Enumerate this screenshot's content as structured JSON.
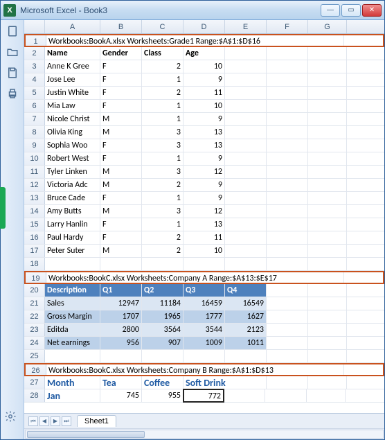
{
  "window": {
    "title": "Microsoft Excel - Book3",
    "min": "—",
    "max": "▭",
    "close": "✕"
  },
  "columns": [
    "A",
    "B",
    "C",
    "D",
    "E",
    "F",
    "G"
  ],
  "info1": "Workbooks:BookA.xlsx   Worksheets:Grade1   Range:$A$1:$D$16",
  "hdr1": {
    "a": "Name",
    "b": "Gender",
    "c": "Class",
    "d": "Age"
  },
  "t1": [
    {
      "n": "3",
      "a": "Anne K Gree",
      "b": "F",
      "c": "2",
      "d": "10"
    },
    {
      "n": "4",
      "a": "Jose Lee",
      "b": "F",
      "c": "1",
      "d": "9"
    },
    {
      "n": "5",
      "a": "Justin White",
      "b": "F",
      "c": "2",
      "d": "11"
    },
    {
      "n": "6",
      "a": "Mia Law",
      "b": "F",
      "c": "1",
      "d": "10"
    },
    {
      "n": "7",
      "a": "Nicole Christ",
      "b": "M",
      "c": "1",
      "d": "9"
    },
    {
      "n": "8",
      "a": "Olivia King",
      "b": "M",
      "c": "3",
      "d": "13"
    },
    {
      "n": "9",
      "a": "Sophia Woo",
      "b": "F",
      "c": "3",
      "d": "13"
    },
    {
      "n": "10",
      "a": "Robert  West",
      "b": "F",
      "c": "1",
      "d": "9"
    },
    {
      "n": "11",
      "a": "Tyler Linken",
      "b": "M",
      "c": "3",
      "d": "12"
    },
    {
      "n": "12",
      "a": "Victoria  Adc",
      "b": "M",
      "c": "2",
      "d": "9"
    },
    {
      "n": "13",
      "a": "Bruce Cade",
      "b": "F",
      "c": "1",
      "d": "9"
    },
    {
      "n": "14",
      "a": "Amy Butts",
      "b": "M",
      "c": "3",
      "d": "12"
    },
    {
      "n": "15",
      "a": "Larry Hanlin",
      "b": "F",
      "c": "1",
      "d": "13"
    },
    {
      "n": "16",
      "a": "Paul Hardy",
      "b": "F",
      "c": "2",
      "d": "11"
    },
    {
      "n": "17",
      "a": "Peter Suter",
      "b": "M",
      "c": "2",
      "d": "10"
    }
  ],
  "info2": "Workbooks:BookC.xlsx   Worksheets:Company A   Range:$A$13:$E$17",
  "hdr2": {
    "a": "Description",
    "b": "Q1",
    "c": "Q2",
    "d": "Q3",
    "e": "Q4"
  },
  "t2": [
    {
      "n": "21",
      "a": "Sales",
      "b": "12947",
      "c": "11184",
      "d": "16459",
      "e": "16549",
      "cls": "tbl-alt1"
    },
    {
      "n": "22",
      "a": "Gross Margin",
      "b": "1707",
      "c": "1965",
      "d": "1777",
      "e": "1627",
      "cls": "tbl-alt2"
    },
    {
      "n": "23",
      "a": "Editda",
      "b": "2800",
      "c": "3564",
      "d": "3544",
      "e": "2123",
      "cls": "tbl-alt1"
    },
    {
      "n": "24",
      "a": "Net earnings",
      "b": "956",
      "c": "907",
      "d": "1009",
      "e": "1011",
      "cls": "tbl-alt2"
    }
  ],
  "info3": "Workbooks:BookC.xlsx   Worksheets:Company B   Range:$A$1:$D$13",
  "hdr3": {
    "a": "Month",
    "b": "Tea",
    "c": "Coffee",
    "d": "Soft Drink"
  },
  "t3": [
    {
      "n": "28",
      "a": "Jan",
      "b": "745",
      "c": "955",
      "d": "772"
    }
  ],
  "sheet_tab": "Sheet1",
  "row_blank18": "18",
  "row_blank25": "25",
  "row_info1": "1",
  "row_hdr1": "2",
  "row_info2": "19",
  "row_hdr2": "20",
  "row_info3": "26",
  "row_hdr3": "27"
}
